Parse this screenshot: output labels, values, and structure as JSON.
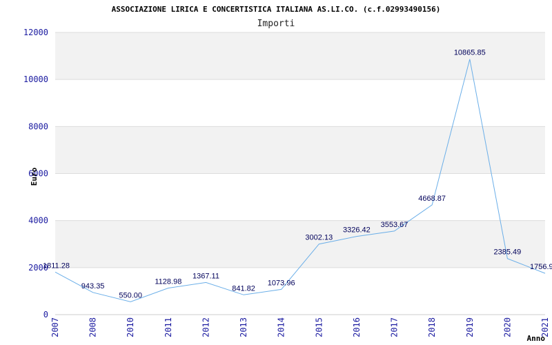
{
  "chart_data": {
    "type": "line",
    "title": "ASSOCIAZIONE LIRICA E CONCERTISTICA ITALIANA AS.LI.CO. (c.f.02993490156)",
    "subtitle": "Importi",
    "ylabel": "Euro",
    "xlabel": "Anno",
    "ylim": [
      0,
      12000
    ],
    "yticks": [
      0,
      2000,
      4000,
      6000,
      8000,
      10000,
      12000
    ],
    "grid": true,
    "x": [
      "2007",
      "2008",
      "2010",
      "2011",
      "2012",
      "2013",
      "2014",
      "2015",
      "2016",
      "2017",
      "2018",
      "2019",
      "2020",
      "2021"
    ],
    "values": [
      1811.28,
      943.35,
      550.0,
      1128.98,
      1367.11,
      841.82,
      1073.96,
      3002.13,
      3326.42,
      3553.67,
      4668.87,
      10865.85,
      2385.49,
      1756.9
    ],
    "data_labels": [
      "1811.28",
      "943.35",
      "550.00",
      "1128.98",
      "1367.11",
      "841.82",
      "1073.96",
      "3002.13",
      "3326.42",
      "3553.67",
      "4668.87",
      "10865.85",
      "2385.49",
      "1756.9"
    ],
    "colors": {
      "line": "#6aaee8",
      "band": "#f2f2f2",
      "grid": "#dcdcdc",
      "axis_text": "#1a1aa0",
      "data_label": "#00005a",
      "title": "#000000"
    }
  }
}
